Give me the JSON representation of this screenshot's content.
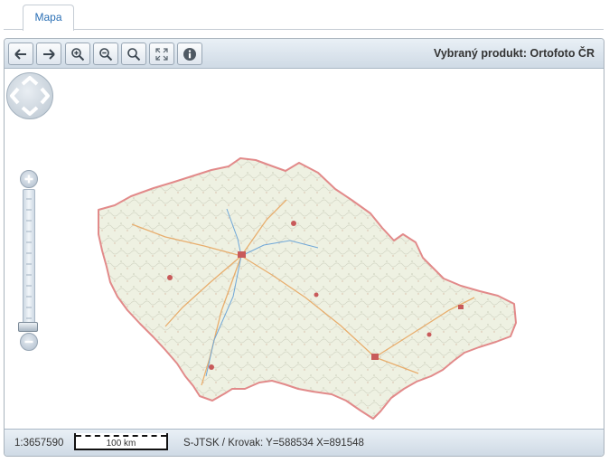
{
  "tabs": [
    {
      "label": "Mapa",
      "active": true
    }
  ],
  "toolbar": {
    "buttons": [
      {
        "name": "back-button",
        "icon": "arrow-left-icon"
      },
      {
        "name": "forward-button",
        "icon": "arrow-right-icon"
      },
      {
        "name": "zoom-in-button",
        "icon": "zoom-in-icon"
      },
      {
        "name": "zoom-out-button",
        "icon": "zoom-out-icon"
      },
      {
        "name": "zoom-box-button",
        "icon": "magnifier-icon"
      },
      {
        "name": "full-extent-button",
        "icon": "expand-icon"
      },
      {
        "name": "info-button",
        "icon": "info-icon"
      }
    ],
    "product_label": "Vybraný produkt: Ortofoto ČR"
  },
  "map": {
    "pan_control": {
      "icon": "pan-arrows-icon"
    },
    "zoom_slider": {
      "plus_icon": "plus-icon",
      "minus_icon": "minus-icon"
    }
  },
  "statusbar": {
    "scale": "1:3657590",
    "scalebar_label": "100 km",
    "coordinates": "S-JTSK / Krovak: Y=588534 X=891548"
  },
  "colors": {
    "accent": "#2a6fb5",
    "border": "#a9b3bd",
    "border_red": "#e28a8a"
  }
}
